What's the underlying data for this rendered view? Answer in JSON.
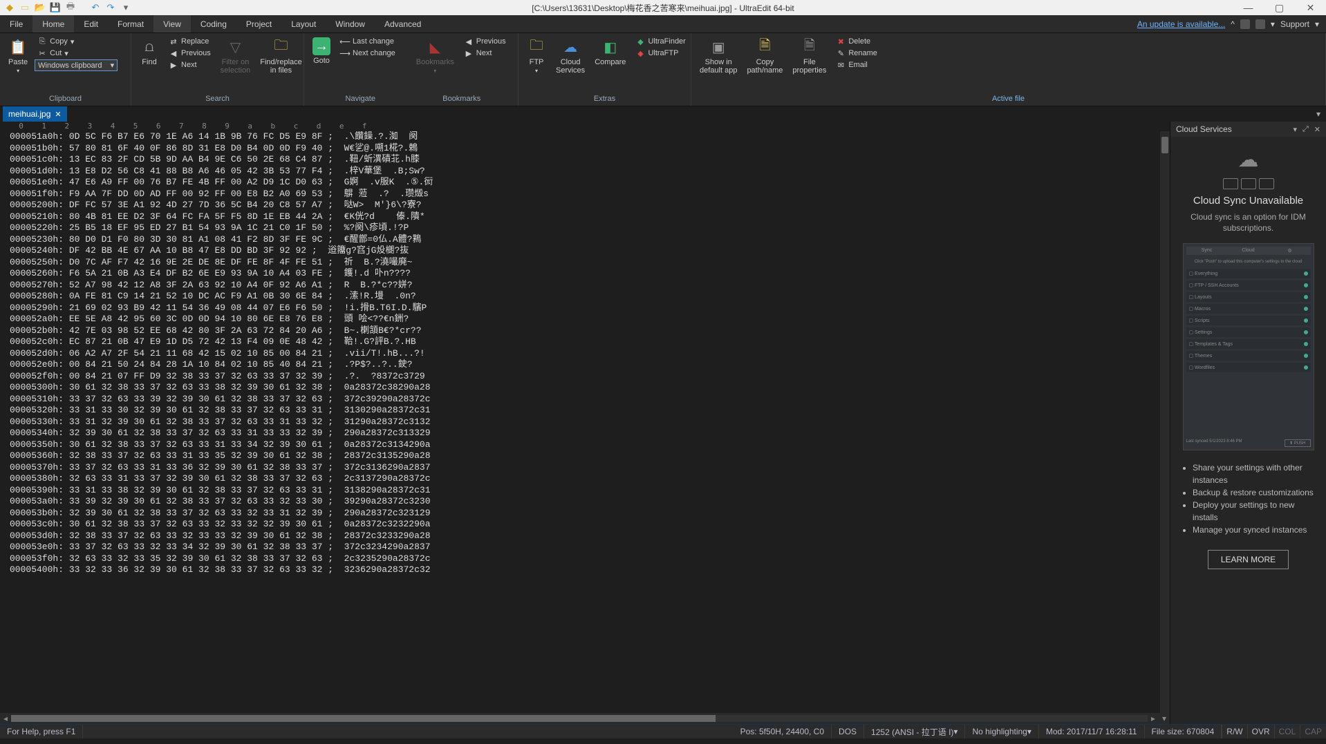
{
  "title": "[C:\\Users\\13631\\Desktop\\梅花香之苦寒来\\meihuai.jpg] - UltraEdit 64-bit",
  "menus": {
    "file": "File",
    "home": "Home",
    "edit": "Edit",
    "format": "Format",
    "view": "View",
    "coding": "Coding",
    "project": "Project",
    "layout": "Layout",
    "window": "Window",
    "advanced": "Advanced"
  },
  "update": "An update is available...",
  "support": "Support",
  "ribbon": {
    "clipboard": {
      "paste": "Paste",
      "copy": "Copy",
      "cut": "Cut",
      "combo": "Windows clipboard",
      "label": "Clipboard"
    },
    "search": {
      "find": "Find",
      "replace": "Replace",
      "previous": "Previous",
      "next": "Next",
      "filter": "Filter on\nselection",
      "findrep": "Find/replace\nin files",
      "label": "Search"
    },
    "navigate": {
      "goto": "Goto",
      "lastchange": "Last change",
      "nextchange": "Next change",
      "prev": "Previous",
      "next": "Next",
      "bookmarks": "Bookmarks",
      "label": "Navigate",
      "sublabel": "Bookmarks"
    },
    "extras": {
      "ftp": "FTP",
      "cloud": "Cloud\nServices",
      "compare": "Compare",
      "uf": "UltraFinder",
      "uftp": "UltraFTP",
      "label": "Extras"
    },
    "active": {
      "showin": "Show in\ndefault app",
      "copypath": "Copy\npath/name",
      "fileprops": "File\nproperties",
      "delete": "Delete",
      "rename": "Rename",
      "email": "Email",
      "label": "Active file"
    }
  },
  "tab": {
    "name": "meihuai.jpg"
  },
  "ruler": "  0    1    2    3    4    5    6    7    8    9    a    b    c    d    e    f",
  "hex": [
    "000051a0h: 0D 5C F6 B7 E6 70 1E A6 14 1B 9B 76 FC D5 E9 8F ;  .\\饡鐰.?.洳  阕",
    "000051b0h: 57 80 81 6F 40 0F 86 8D 31 E8 D0 B4 0D 0D F9 40 ;  W€乷@.嗍1椛?.鵣",
    "000051c0h: 13 EC 83 2F CD 5B 9D AA B4 9E C6 50 2E 68 C4 87 ;  .靵/蚚潩磧苝.h膝",
    "000051d0h: 13 E8 D2 56 C8 41 88 B8 A6 46 05 42 3B 53 77 F4 ;  .梓V華堡  .B;Sw?",
    "000051e0h: 47 E6 A9 FF 00 76 B7 FE 4B FF 00 A2 D9 1C D0 63 ;  G婀  .v服K  .⑤.衏",
    "000051f0h: F9 AA 7F DD 0D AD FF 00 92 FF 00 E8 B2 A0 69 53 ;  鵿 蒞  .?  .瓒燬s",
    "00005200h: DF FC 57 3E A1 92 4D 27 7D 36 5C B4 20 C8 57 A7 ;  哒W>  M'}6\\?寮?",
    "00005210h: 80 4B 81 EE D2 3F 64 FC FA 5F F5 8D 1E EB 44 2A ;  €K侊?d    傣.隤*",
    "00005220h: 25 B5 18 EF 95 ED 27 B1 54 93 9A 1C 21 C0 1F 50 ;  %?阕\\疹頃.!?P",
    "00005230h: 80 D0 D1 F0 80 3D 30 81 A1 08 41 F2 8D 3F FE 9C ;  €醒鄫=0仏.A體?鶜",
    "00005240h: DF 42 BB 4E 67 AA 10 B8 47 E8 DD BD 3F 92 92 ;  逧籒g?窞jG炈樃?抜",
    "00005250h: D0 7C AF F7 42 16 9E 2E DE 8E DF FE 8F 4F FE 51 ;  祈  B.?澆嘬廃~",
    "00005260h: F6 5A 21 0B A3 E4 DF B2 6E E9 93 9A 10 A4 03 FE ;  鑊!.d 卟n????",
    "00005270h: 52 A7 98 42 12 A8 3F 2A 63 92 10 A4 0F 92 A6 A1 ;  R  B.?*c??姘?",
    "00005280h: 0A FE 81 C9 14 21 52 10 DC AC F9 A1 0B 30 6E 84 ;  .溹!R.墁  .0n?",
    "00005290h: 21 69 02 93 B9 42 11 54 36 49 08 44 07 E6 F6 50 ;  !i.搰B.T6I.D.驞P",
    "000052a0h: EE 5E A8 42 95 60 3C 0D 0D 94 10 80 6E E8 76 E8 ;  頭 哙<??€n銂?",
    "000052b0h: 42 7E 03 98 52 EE 68 42 80 3F 2A 63 72 84 20 A6 ;  B~.楋頷B€?*cr??",
    "000052c0h: EC 87 21 0B 47 E9 1D D5 72 42 13 F4 09 0E 48 42 ;  鞈!.G?評B.?.HB",
    "000052d0h: 06 A2 A7 2F 54 21 11 68 42 15 02 10 85 00 84 21 ;  .vii/T!.hB...?!",
    "000052e0h: 00 84 21 50 24 84 28 1A 10 84 02 10 85 40 84 21 ;  .?P$?..?..鉂?",
    "000052f0h: 00 84 21 07 FF D9 32 38 33 37 32 63 33 37 32 39 ;  .?.  ?8372c3729",
    "00005300h: 30 61 32 38 33 37 32 63 33 38 32 39 30 61 32 38 ;  0a28372c38290a28",
    "00005310h: 33 37 32 63 33 39 32 39 30 61 32 38 33 37 32 63 ;  372c39290a28372c",
    "00005320h: 33 31 33 30 32 39 30 61 32 38 33 37 32 63 33 31 ;  3130290a28372c31",
    "00005330h: 33 31 32 39 30 61 32 38 33 37 32 63 33 31 33 32 ;  31290a28372c3132",
    "00005340h: 32 39 30 61 32 38 33 37 32 63 33 31 33 33 32 39 ;  290a28372c313329",
    "00005350h: 30 61 32 38 33 37 32 63 33 31 33 34 32 39 30 61 ;  0a28372c3134290a",
    "00005360h: 32 38 33 37 32 63 33 31 33 35 32 39 30 61 32 38 ;  28372c3135290a28",
    "00005370h: 33 37 32 63 33 31 33 36 32 39 30 61 32 38 33 37 ;  372c3136290a2837",
    "00005380h: 32 63 33 31 33 37 32 39 30 61 32 38 33 37 32 63 ;  2c3137290a28372c",
    "00005390h: 33 31 33 38 32 39 30 61 32 38 33 37 32 63 33 31 ;  3138290a28372c31",
    "000053a0h: 33 39 32 39 30 61 32 38 33 37 32 63 33 32 33 30 ;  39290a28372c3230",
    "000053b0h: 32 39 30 61 32 38 33 37 32 63 33 32 33 31 32 39 ;  290a28372c323129",
    "000053c0h: 30 61 32 38 33 37 32 63 33 32 33 32 32 39 30 61 ;  0a28372c3232290a",
    "000053d0h: 32 38 33 37 32 63 33 32 33 33 32 39 30 61 32 38 ;  28372c3233290a28",
    "000053e0h: 33 37 32 63 33 32 33 34 32 39 30 61 32 38 33 37 ;  372c3234290a2837",
    "000053f0h: 32 63 33 32 33 35 32 39 30 61 32 38 33 37 32 63 ;  2c3235290a28372c",
    "00005400h: 33 32 33 36 32 39 30 61 32 38 33 37 32 63 33 32 ;  3236290a28372c32"
  ],
  "sidepanel": {
    "title": "Cloud Services",
    "unavail": "Cloud Sync Unavailable",
    "desc": "Cloud sync is an option for IDM subscriptions.",
    "bullets": [
      "Share your settings with other instances",
      "Backup & restore customizations",
      "Deploy your settings to new installs",
      "Manage your synced instances"
    ],
    "learn": "LEARN MORE"
  },
  "status": {
    "help": "For Help, press F1",
    "pos": "Pos: 5f50H, 24400, C0",
    "dos": "DOS",
    "enc": "1252  (ANSI - 拉丁语 I)",
    "hl": "No highlighting",
    "mod": "Mod: 2017/11/7 16:28:11",
    "size": "File size: 670804",
    "rw": "R/W",
    "ovr": "OVR",
    "col": "COL",
    "cap": "CAP"
  }
}
